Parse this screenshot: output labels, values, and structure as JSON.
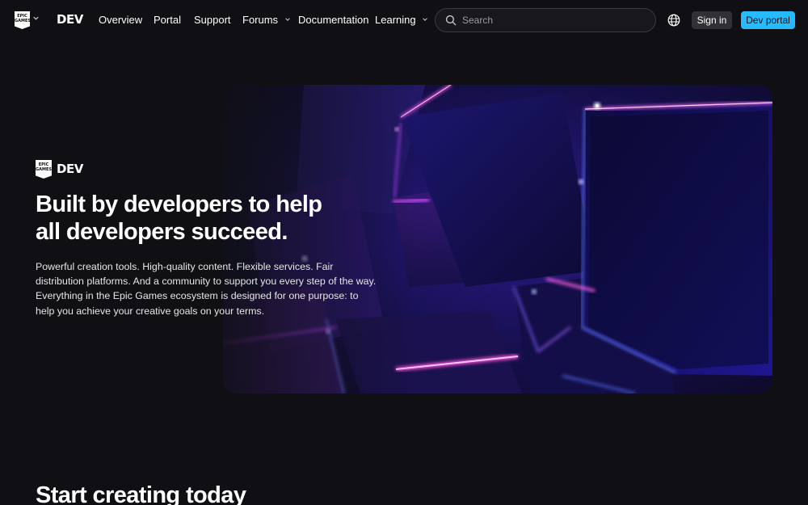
{
  "navbar": {
    "logo_lines": [
      "EPIC",
      "GAMES"
    ],
    "dev_mark": "DEV",
    "items": [
      {
        "label": "Overview",
        "dropdown": false
      },
      {
        "label": "Portal",
        "dropdown": false
      },
      {
        "label": "Support",
        "dropdown": false
      },
      {
        "label": "Forums",
        "dropdown": true
      },
      {
        "label": "Documentation",
        "dropdown": false
      },
      {
        "label": "Learning",
        "dropdown": true
      }
    ],
    "search_placeholder": "Search",
    "signin_label": "Sign in",
    "devportal_label": "Dev portal",
    "icons": [
      "epic-games-logo",
      "chevron-down-icon",
      "search-icon",
      "globe-icon"
    ]
  },
  "hero": {
    "logo_lines": [
      "EPIC",
      "GAMES"
    ],
    "dev_mark": "DEV",
    "title_line1": "Built by developers to help",
    "title_line2": "all developers succeed.",
    "description": "Powerful creation tools. High-quality content. Flexible services. Fair distribution platforms. And a community to support you every step of the way. Everything in the Epic Games ecosystem is designed for one purpose: to help you achieve your creative goals on your terms."
  },
  "section": {
    "title": "Start creating today"
  },
  "colors": {
    "background": "#101014",
    "accent": "#26bbff",
    "secondary_button": "#303035"
  }
}
